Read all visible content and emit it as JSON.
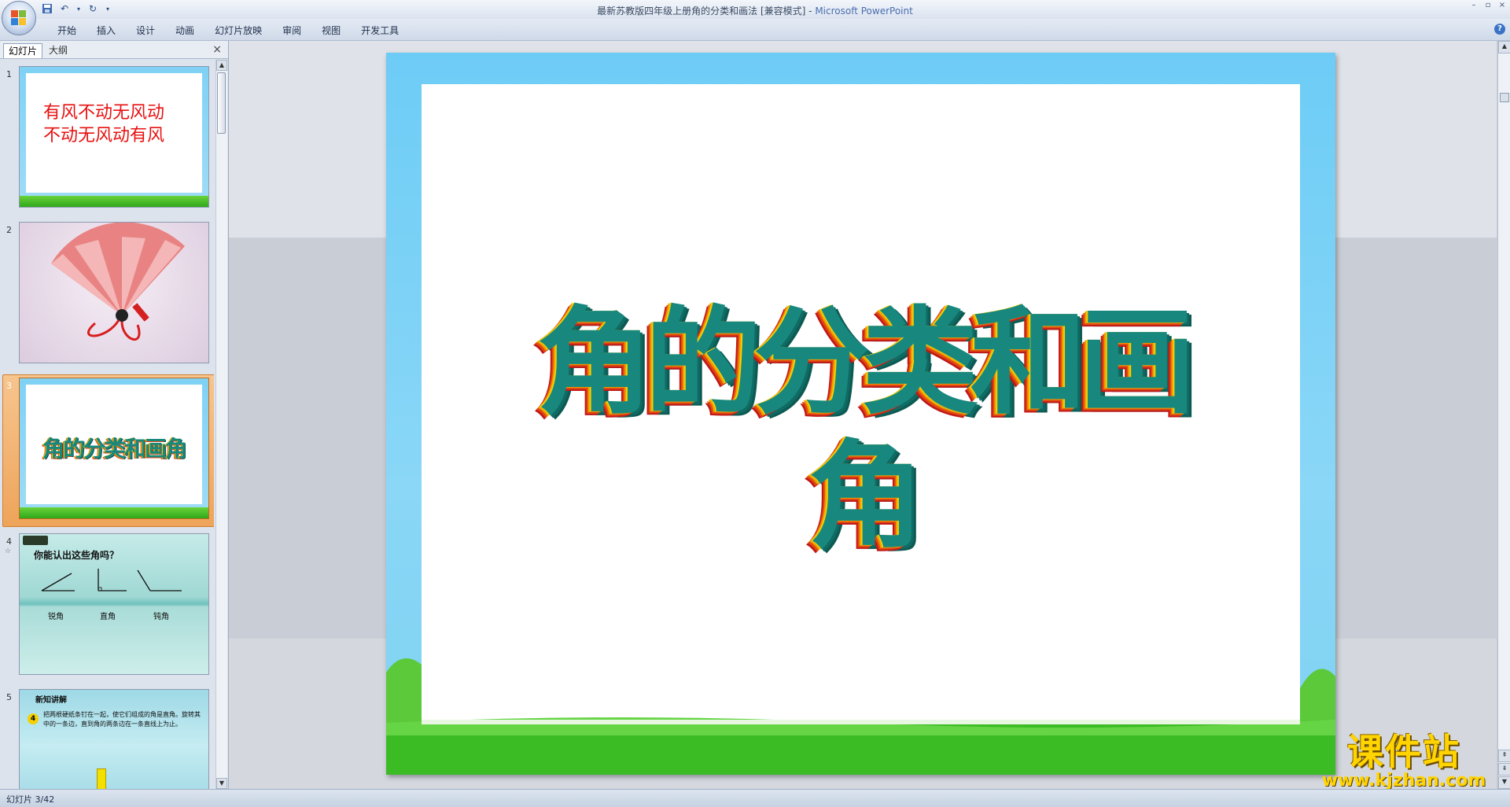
{
  "window": {
    "title": "最新苏教版四年级上册角的分类和画法 [兼容模式] - ",
    "app_name": "Microsoft PowerPoint",
    "controls": [
      "–",
      "▫",
      "×"
    ]
  },
  "ribbon": {
    "tabs": [
      "开始",
      "插入",
      "设计",
      "动画",
      "幻灯片放映",
      "审阅",
      "视图",
      "开发工具"
    ],
    "help": "?"
  },
  "pane": {
    "tab_slides": "幻灯片",
    "tab_outline": "大纲",
    "close": "×",
    "thumbnails": [
      {
        "num": "1",
        "lines": [
          "有风不动无风动",
          "不动无风动有风"
        ]
      },
      {
        "num": "2"
      },
      {
        "num": "3",
        "title": "角的分类和画角"
      },
      {
        "num": "4",
        "sub": "☆",
        "heading": "你能认出这些角吗？",
        "labels": [
          "锐角",
          "直角",
          "钝角"
        ]
      },
      {
        "num": "5",
        "heading": "新知讲解",
        "badge": "4",
        "body": "把两根硬纸条钉在一起，使它们组成的角是直角。旋转其中的一条边，直到角的两条边在一条直线上为止。"
      }
    ]
  },
  "slide": {
    "title": "角的分类和画角"
  },
  "watermark": {
    "cn": "课件站",
    "url": "www.kjzhan.com"
  },
  "status": {
    "slide_info": "幻灯片 3/42"
  }
}
